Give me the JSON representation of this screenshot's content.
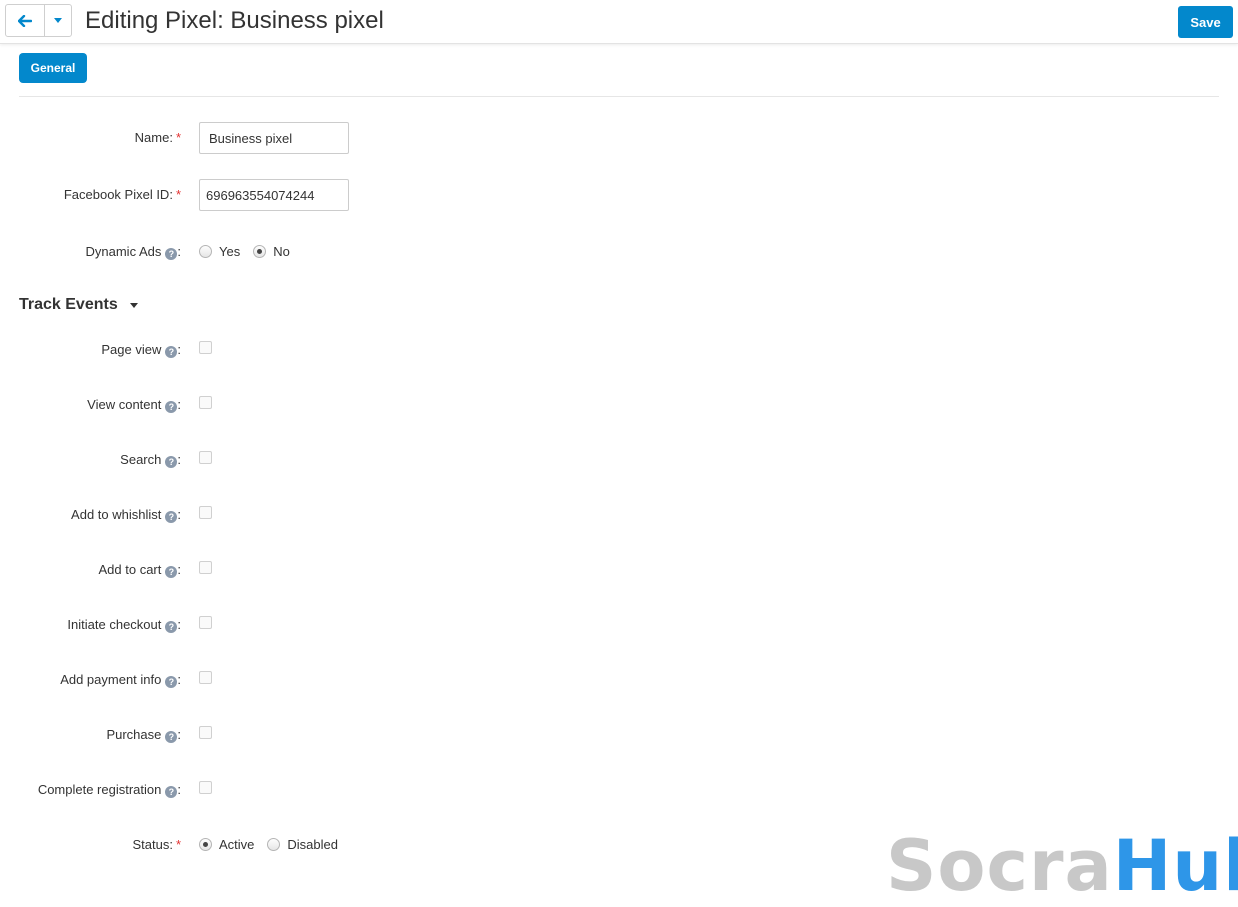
{
  "header": {
    "back_icon": "arrow-left-icon",
    "dropdown_icon": "caret-down-icon",
    "title": "Editing Pixel: Business pixel",
    "save_label": "Save",
    "accent": "#0388cc"
  },
  "tabs": [
    {
      "label": "General",
      "active": true
    }
  ],
  "form": {
    "name": {
      "label": "Name:",
      "required": "*",
      "value": "Business pixel"
    },
    "pixel_id": {
      "label": "Facebook Pixel ID:",
      "required": "*",
      "value": "696963554074244"
    },
    "dynamic_ads": {
      "label": "Dynamic Ads",
      "suffix": ":",
      "options": [
        "Yes",
        "No"
      ],
      "selected": "No"
    }
  },
  "track_events": {
    "title": "Track Events",
    "items": [
      {
        "label": "Page view",
        "checked": false
      },
      {
        "label": "View content",
        "checked": false
      },
      {
        "label": "Search",
        "checked": false
      },
      {
        "label": "Add to whishlist",
        "checked": false
      },
      {
        "label": "Add to cart",
        "checked": false
      },
      {
        "label": "Initiate checkout",
        "checked": false
      },
      {
        "label": "Add payment info",
        "checked": false
      },
      {
        "label": "Purchase",
        "checked": false
      },
      {
        "label": "Complete registration",
        "checked": false
      }
    ],
    "suffix": ":"
  },
  "status": {
    "label": "Status:",
    "required": "*",
    "options": [
      "Active",
      "Disabled"
    ],
    "selected": "Active"
  },
  "watermark": {
    "part1": "Socra",
    "part2": "Hub",
    "color1": "#c8c8c8",
    "color2": "#2e96e8"
  }
}
